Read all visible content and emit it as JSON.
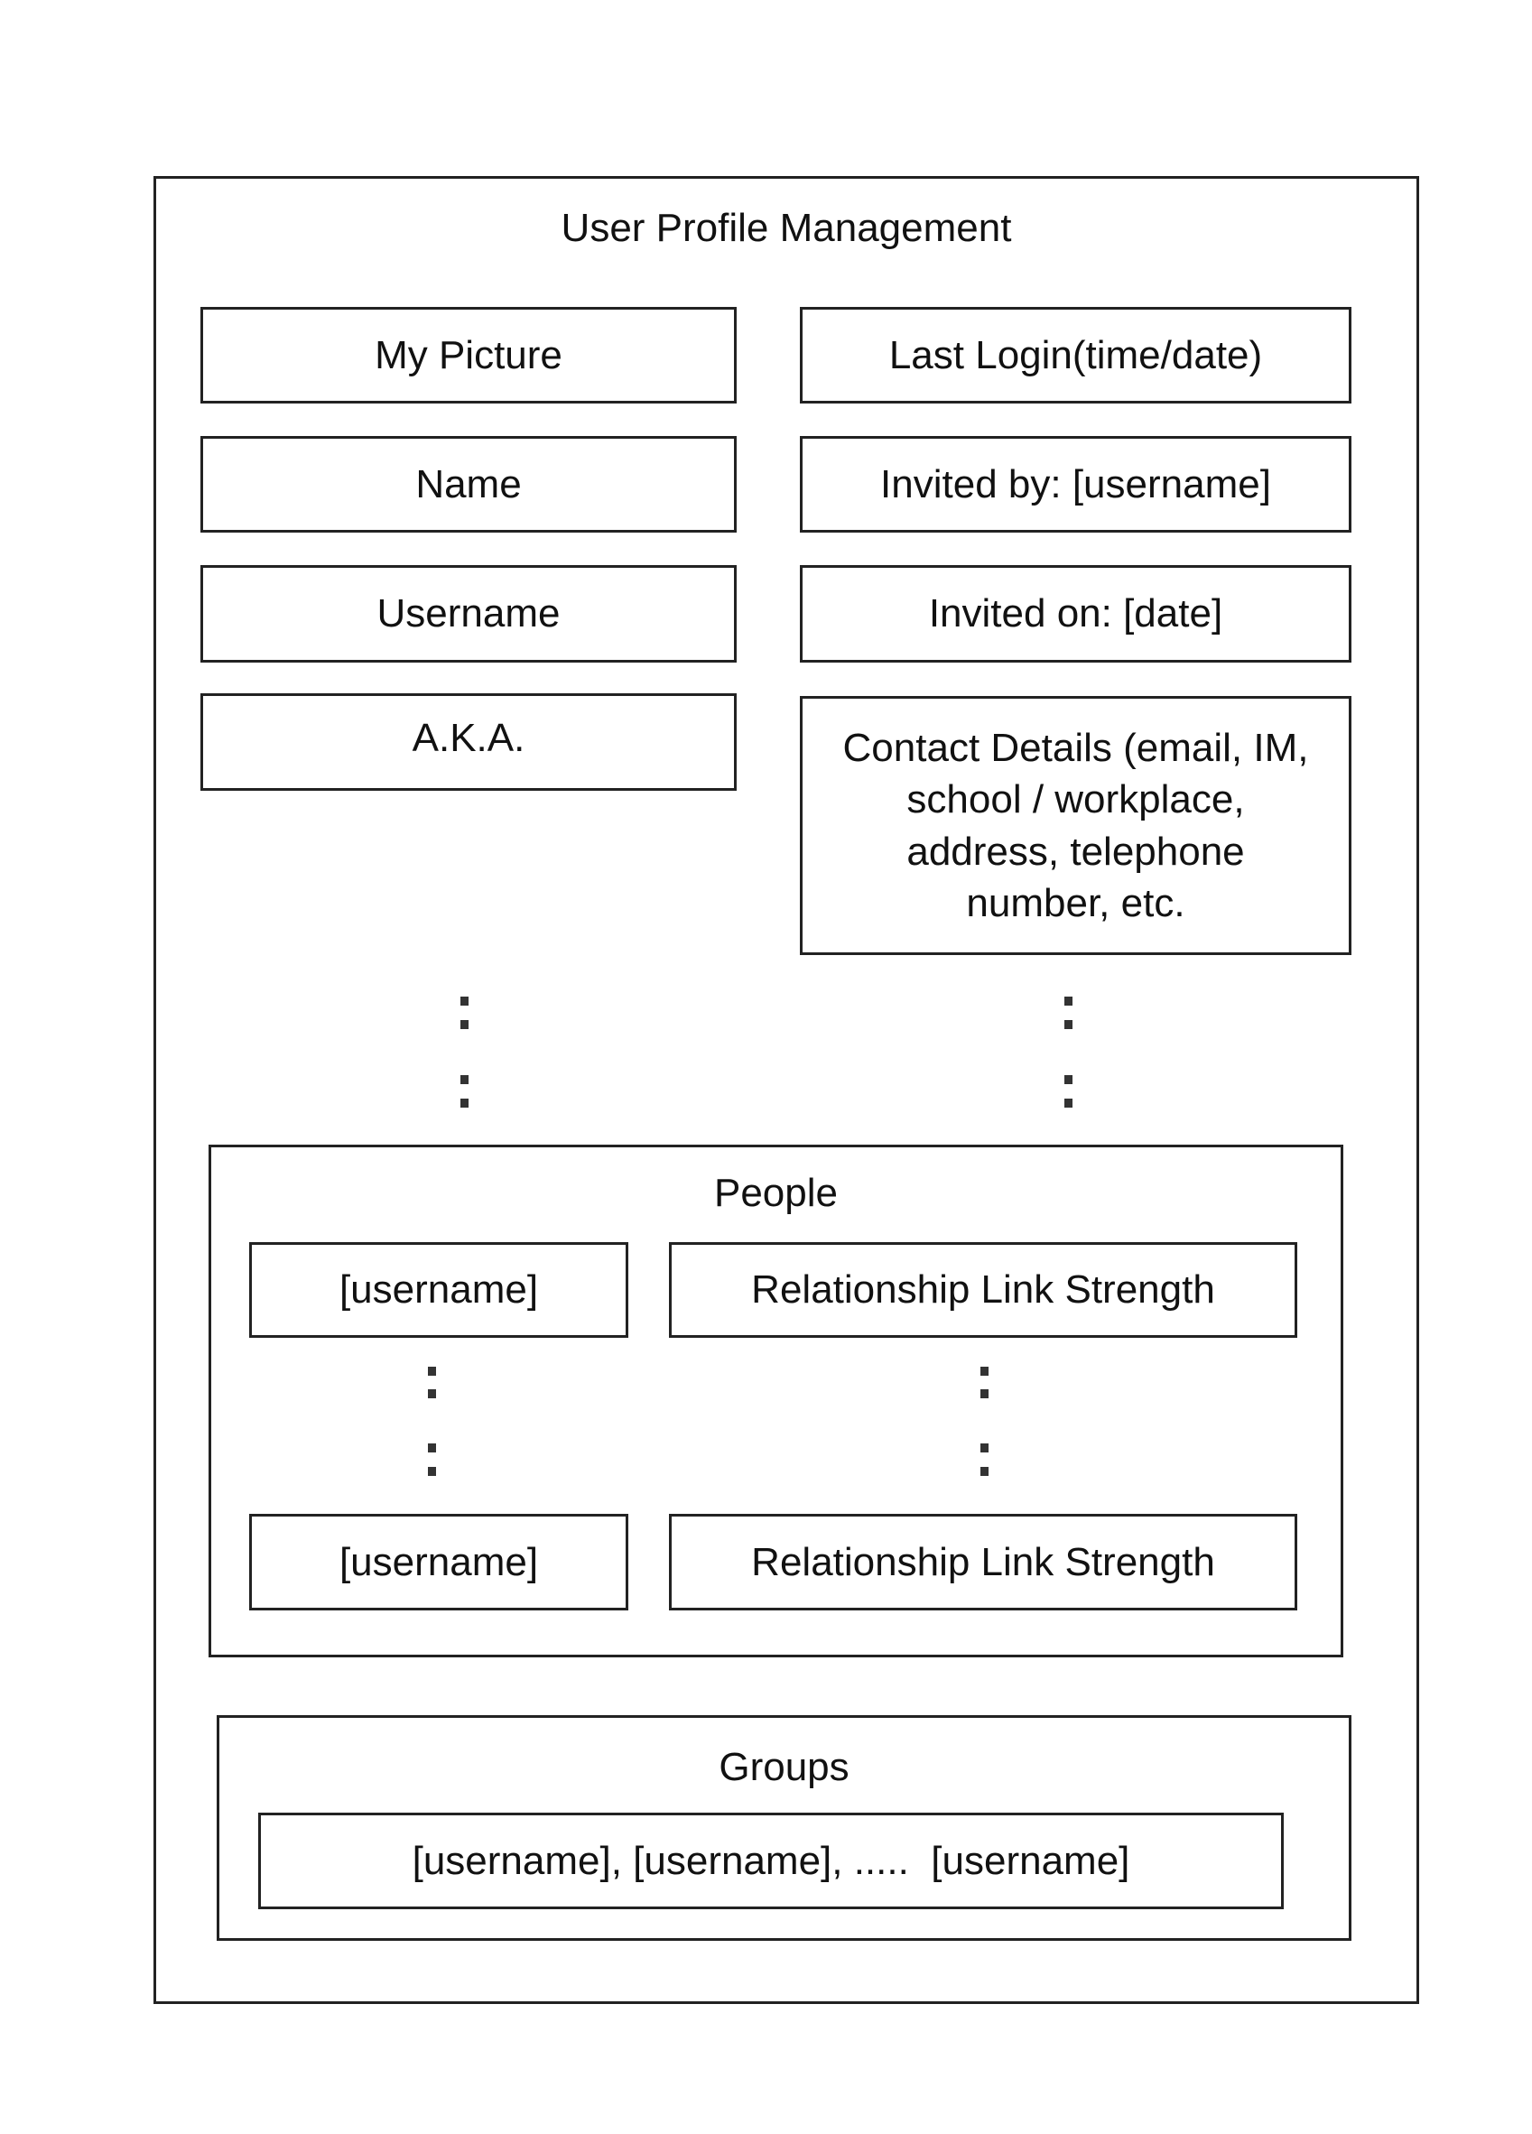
{
  "title": "User Profile Management",
  "left_fields": [
    "My Picture",
    "Name",
    "Username",
    "A.K.A."
  ],
  "right_fields": [
    "Last Login(time/date)",
    "Invited by: [username]",
    "Invited on: [date]",
    "Contact Details (email, IM, school / workplace, address, telephone number, etc."
  ],
  "people": {
    "title": "People",
    "rows": [
      {
        "username": "[username]",
        "strength": "Relationship Link Strength"
      },
      {
        "username": "[username]",
        "strength": "Relationship Link Strength"
      }
    ]
  },
  "groups": {
    "title": "Groups",
    "members": "[username], [username], .....  [username]"
  }
}
